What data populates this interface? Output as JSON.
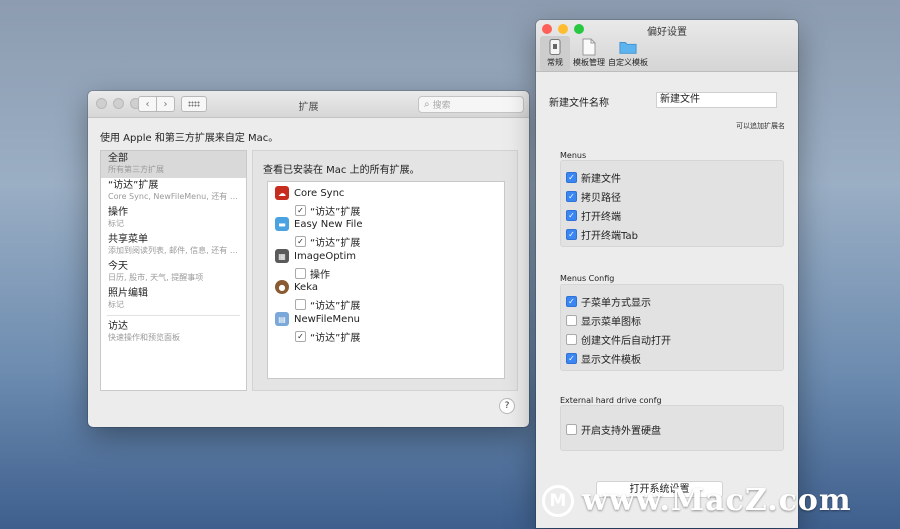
{
  "extensions_window": {
    "title": "扩展",
    "nav_back": "‹",
    "nav_forward": "›",
    "search_placeholder": "搜索",
    "description": "使用 Apple 和第三方扩展来自定 Mac。",
    "sidebar": [
      {
        "title": "全部",
        "subtitle": "所有第三方扩展",
        "selected": true
      },
      {
        "title": "“访达”扩展",
        "subtitle": "Core Sync, NewFileMenu, 还有 1 个…"
      },
      {
        "title": "操作",
        "subtitle": "标记"
      },
      {
        "title": "共享菜单",
        "subtitle": "添加到阅读列表, 邮件, 信息, 还有 6 个…"
      },
      {
        "title": "今天",
        "subtitle": "日历, 股市, 天气, 提醒事项"
      },
      {
        "title": "照片编辑",
        "subtitle": "标记"
      },
      {
        "title": "访达",
        "subtitle": "快速操作和预览面板"
      }
    ],
    "main_heading": "查看已安装在 Mac 上的所有扩展。",
    "apps": [
      {
        "name": "Core Sync",
        "ext": "“访达”扩展",
        "checked": true,
        "icon_color": "#c62d1f"
      },
      {
        "name": "Easy New File",
        "ext": "“访达”扩展",
        "checked": true,
        "icon_color": "#4aa3e0"
      },
      {
        "name": "ImageOptim",
        "ext": "操作",
        "checked": false,
        "icon_color": "#5a5a5a"
      },
      {
        "name": "Keka",
        "ext": "“访达”扩展",
        "checked": false,
        "icon_color": "#8a5a32"
      },
      {
        "name": "NewFileMenu",
        "ext": "“访达”扩展",
        "checked": true,
        "icon_color": "#7aa8d8"
      }
    ],
    "help": "?"
  },
  "prefs_window": {
    "title": "偏好设置",
    "tabs": [
      {
        "label": "常规",
        "selected": true
      },
      {
        "label": "模板管理"
      },
      {
        "label": "自定义模板"
      }
    ],
    "new_file_name_label": "新建文件名称",
    "new_file_name_value": "新建文件",
    "extension_hint": "可以追加扩展名",
    "groups": [
      {
        "label": "Menus",
        "options": [
          {
            "text": "新建文件",
            "checked": true
          },
          {
            "text": "拷贝路径",
            "checked": true
          },
          {
            "text": "打开终端",
            "checked": true
          },
          {
            "text": "打开终端Tab",
            "checked": true
          }
        ]
      },
      {
        "label": "Menus Config",
        "options": [
          {
            "text": "子菜单方式显示",
            "checked": true
          },
          {
            "text": "显示菜单图标",
            "checked": false
          },
          {
            "text": "创建文件后自动打开",
            "checked": false
          },
          {
            "text": "显示文件模板",
            "checked": true
          }
        ]
      },
      {
        "label": "External hard drive confg",
        "options": [
          {
            "text": "开启支持外置硬盘",
            "checked": false
          }
        ]
      }
    ],
    "open_system_settings": "打开系统设置"
  },
  "watermark": {
    "logo": "M",
    "text": "www.MacZ.com"
  },
  "colors": {
    "close": "#fe5f57",
    "minimize": "#febc2e",
    "zoom": "#28c840",
    "accent": "#3a86f2"
  }
}
